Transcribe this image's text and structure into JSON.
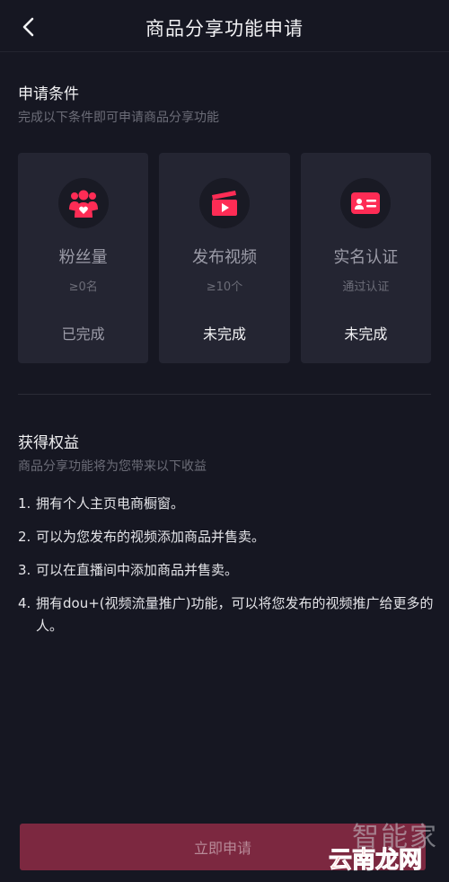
{
  "header": {
    "title": "商品分享功能申请",
    "back_icon": "chevron-left-icon"
  },
  "conditions": {
    "title": "申请条件",
    "subtitle": "完成以下条件即可申请商品分享功能",
    "items": [
      {
        "name": "粉丝量",
        "requirement": "≥0名",
        "status": "已完成",
        "icon": "fans-icon"
      },
      {
        "name": "发布视频",
        "requirement": "≥10个",
        "status": "未完成",
        "icon": "video-clapper-icon"
      },
      {
        "name": "实名认证",
        "requirement": "通过认证",
        "status": "未完成",
        "icon": "id-card-icon"
      }
    ]
  },
  "benefits": {
    "title": "获得权益",
    "subtitle": "商品分享功能将为您带来以下收益",
    "items": [
      {
        "num": "1.",
        "text": "拥有个人主页电商橱窗。"
      },
      {
        "num": "2.",
        "text": "可以为您发布的视频添加商品并售卖。"
      },
      {
        "num": "3.",
        "text": "可以在直播间中添加商品并售卖。"
      },
      {
        "num": "4.",
        "text": "拥有dou+(视频流量推广)功能，可以将您发布的视频推广给更多的人。"
      }
    ]
  },
  "apply_button": {
    "label": "立即申请"
  },
  "watermark": {
    "line1": "智能家",
    "line2": "云南龙网"
  },
  "colors": {
    "background": "#161722",
    "card": "#242532",
    "accent": "#fe2c55",
    "button": "#7c2840"
  }
}
